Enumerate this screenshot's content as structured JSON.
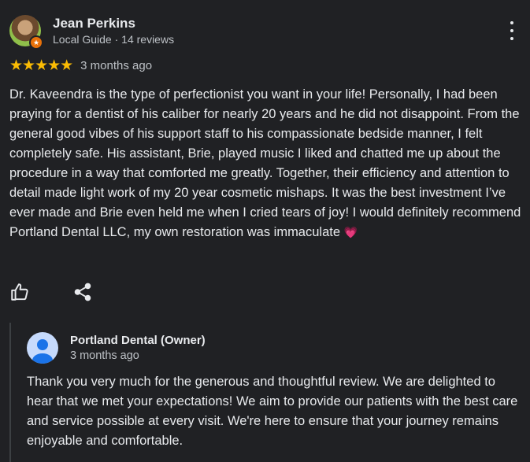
{
  "reviewer": {
    "name": "Jean Perkins",
    "subtitle": "Local Guide · 14 reviews",
    "badge_icon": "local-guide-star-icon"
  },
  "review": {
    "stars": "★★★★★",
    "rating": 5,
    "date": "3 months ago",
    "text": "Dr. Kaveendra is the type of perfectionist you want in your life! Personally, I had been praying for a dentist of his caliber for nearly 20 years and he did not disappoint. From the general good vibes of his support staff to his compassionate bedside manner, I felt completely safe. His assistant, Brie, played music I liked and chatted me up about the procedure in a way that comforted me greatly. Together, their efficiency and attention to detail made light work of my 20 year cosmetic mishaps. It was the best investment I’ve ever made and Brie even held me when I cried tears of joy! I would definitely recommend Portland Dental LLC, my own restoration was immaculate",
    "emoji": "💗"
  },
  "actions": {
    "like_icon": "thumbs-up-icon",
    "share_icon": "share-icon",
    "more_icon": "more-vert-icon"
  },
  "owner_reply": {
    "name": "Portland Dental (Owner)",
    "date": "3 months ago",
    "text": "Thank you very much for the generous and thoughtful review. We are delighted to hear that we met your expectations! We aim to provide our patients with the best care and service possible at every visit. We're here to ensure that your journey remains enjoyable and comfortable."
  },
  "colors": {
    "background": "#202124",
    "star": "#fbbc04",
    "text": "#e8eaed",
    "muted": "#bdc1c6",
    "owner_avatar": "#c6dafc"
  }
}
